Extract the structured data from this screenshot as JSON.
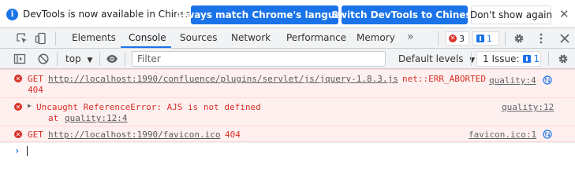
{
  "infobar": {
    "message": "DevTools is now available in Chinese!",
    "primary_button": "Always match Chrome's language",
    "secondary_button": "Switch DevTools to Chinese",
    "dismiss_button": "Don't show again",
    "close_glyph": "✕"
  },
  "tabs": [
    {
      "label": "Elements",
      "active": false
    },
    {
      "label": "Console",
      "active": true
    },
    {
      "label": "Sources",
      "active": false
    },
    {
      "label": "Network",
      "active": false
    },
    {
      "label": "Performance",
      "active": false
    },
    {
      "label": "Memory",
      "active": false
    }
  ],
  "tabbar": {
    "more_tabs_glyph": "»",
    "error_count": "3",
    "message_count": "1"
  },
  "toolbar": {
    "context": "top",
    "filter_placeholder": "Filter",
    "levels": "Default levels",
    "issues_label": "1 Issue:",
    "issues_count": "1"
  },
  "messages": [
    {
      "prefix": "GET",
      "url": "http://localhost:1990/confluence/plugins/servlet/js/jquery-1.8.3.js",
      "suffix": "net::ERR_ABORTED",
      "second_line": "404",
      "source": "quality:4"
    },
    {
      "text": "Uncaught ReferenceError: AJS is not defined",
      "stack_prefix": "at",
      "stack_link": "quality:12:4",
      "source": "quality:12"
    },
    {
      "prefix": "GET",
      "url": "http://localhost:1990/favicon.ico",
      "suffix": "404",
      "source": "favicon.ico:1"
    }
  ],
  "colors": {
    "accent": "#1a73e8",
    "error": "#d93025",
    "error_bg": "#fff0f0"
  }
}
